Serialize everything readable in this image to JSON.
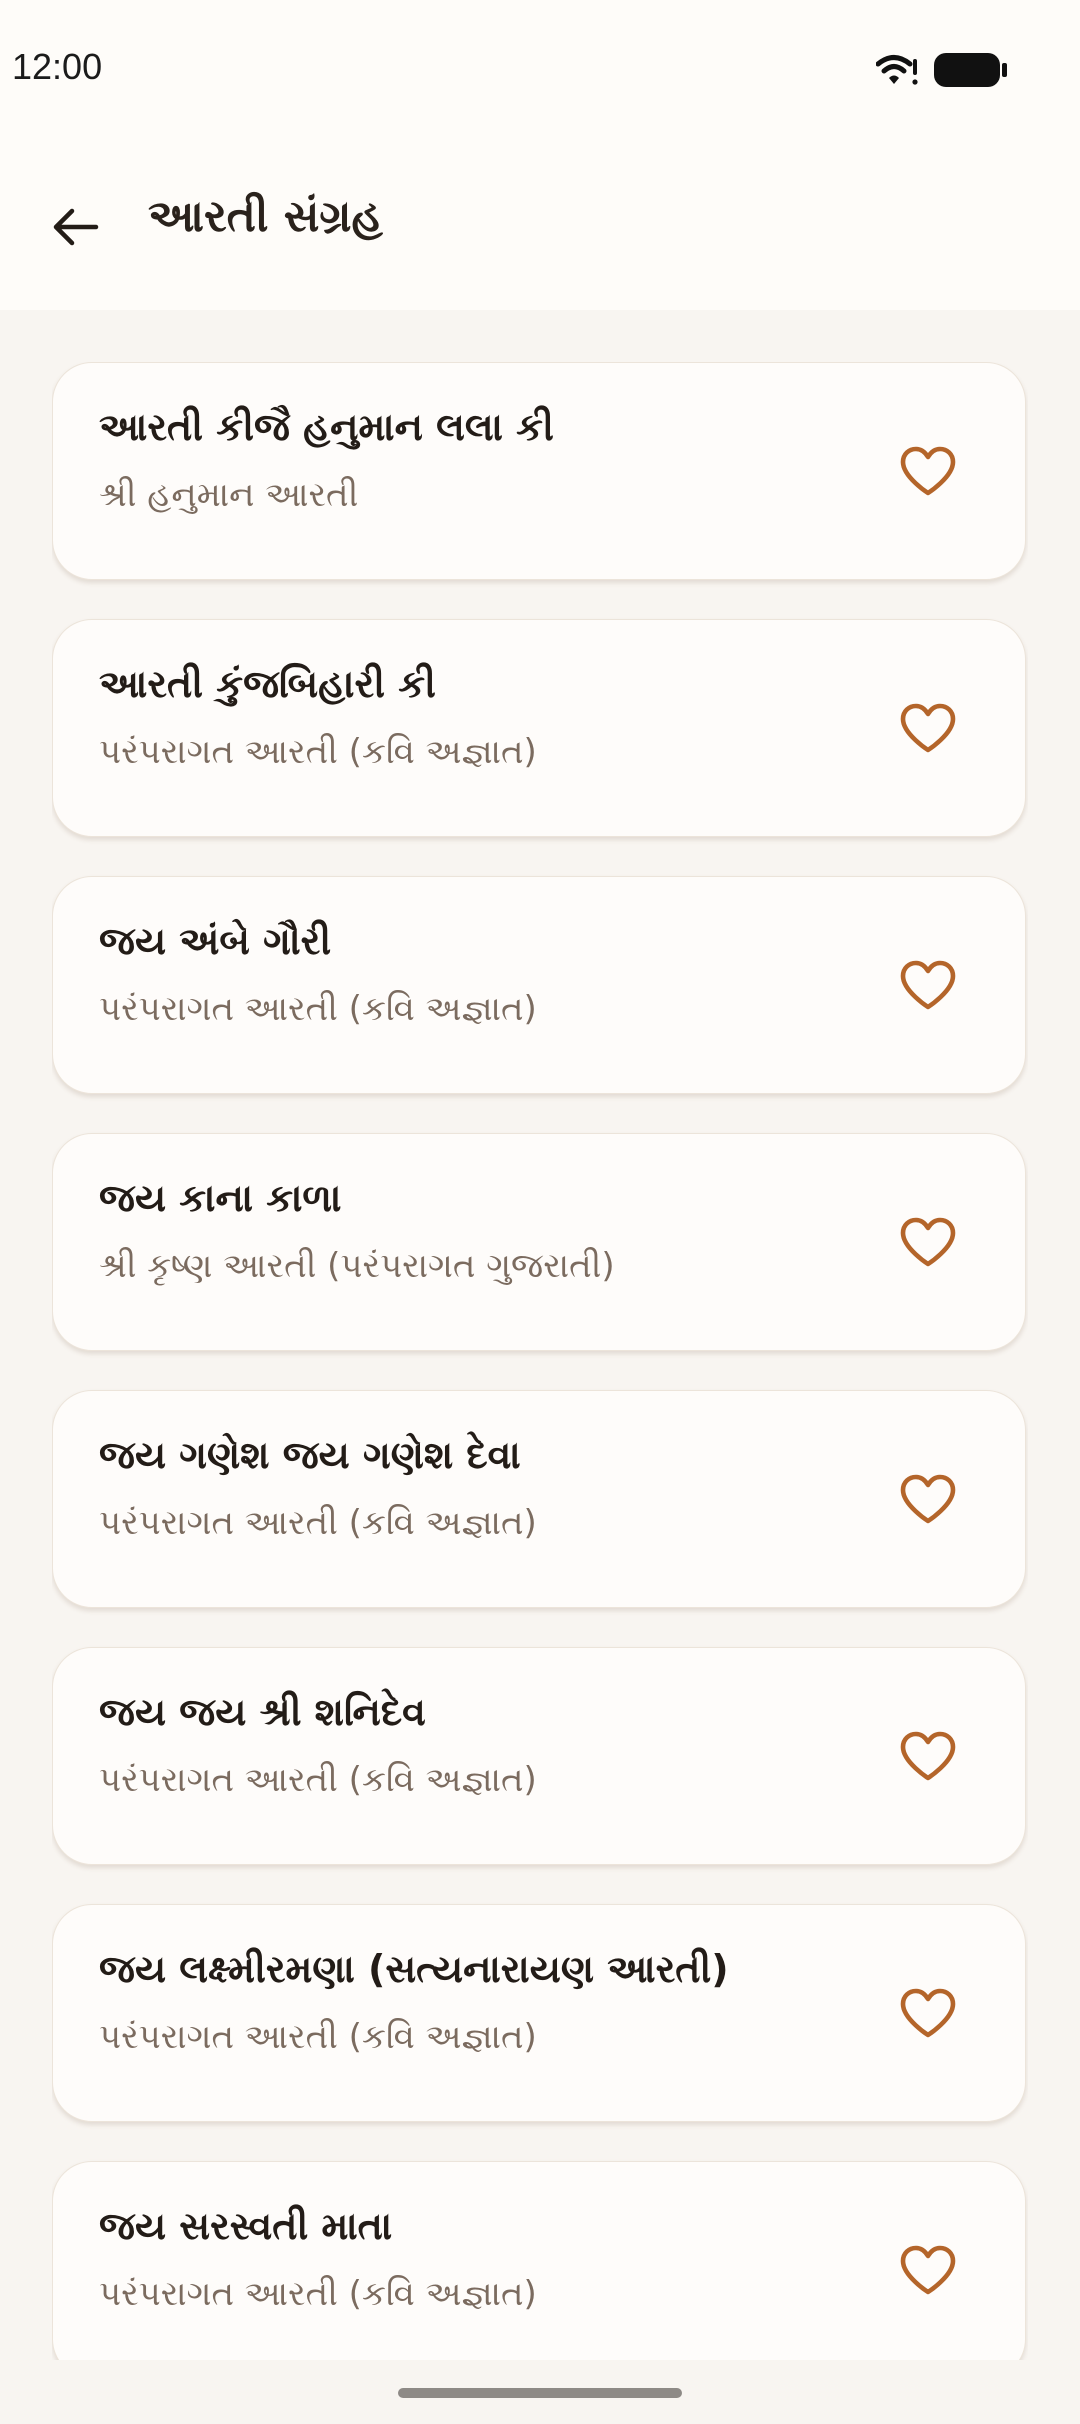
{
  "status_bar": {
    "time": "12:00"
  },
  "header": {
    "title": "આરતી સંગ્રહ",
    "back_icon": "arrow-back-icon"
  },
  "aartis": [
    {
      "title": "આરતી કીજૈ હનુમાન લલા કી",
      "subtitle": "શ્રી હનુમાન આરતી"
    },
    {
      "title": "આરતી કુંજબિહારી કી",
      "subtitle": "પરંપરાગત આરતી (કવિ અજ્ઞાત)"
    },
    {
      "title": "જય અંબે ગૌરી",
      "subtitle": "પરંપરાગત આરતી (કવિ અજ્ઞાત)"
    },
    {
      "title": "જય કાના કાળા",
      "subtitle": "શ્રી કૃષ્ણ આરતી (પરંપરાગત ગુજરાતી)"
    },
    {
      "title": "જય ગણેશ જય ગણેશ દેવા",
      "subtitle": "પરંપરાગત આરતી (કવિ અજ્ઞાત)"
    },
    {
      "title": "જય જય શ્રી શનિદેવ",
      "subtitle": "પરંપરાગત આરતી (કવિ અજ્ઞાત)"
    },
    {
      "title": "જય લક્ષ્મીરમણા (સત્યનારાયણ આરતી)",
      "subtitle": "પરંપરાગત આરતી (કવિ અજ્ઞાત)"
    },
    {
      "title": "જય સરસ્વતી માતા",
      "subtitle": "પરંપરાગત આરતી (કવિ અજ્ઞાત)"
    }
  ],
  "colors": {
    "accent": "#B4652A",
    "background": "#F8F5F1",
    "card": "#FEFCFA",
    "title_text": "#231C17",
    "subtitle_text": "#7B6B5F"
  },
  "icons": {
    "favorite": "heart-outline-icon",
    "wifi": "wifi-icon",
    "battery": "battery-icon"
  }
}
